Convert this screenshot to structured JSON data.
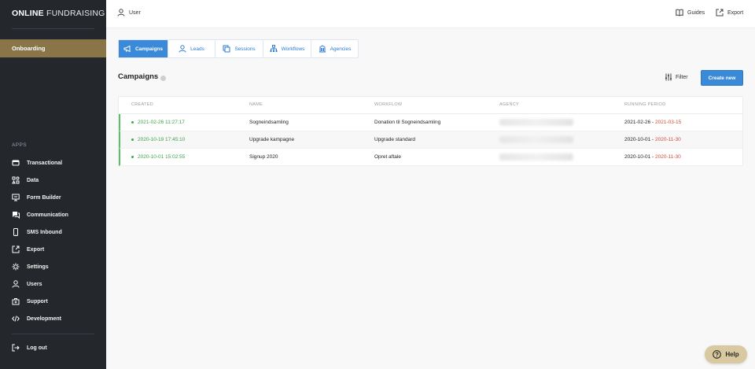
{
  "brand": {
    "bold": "ONLINE",
    "light": "FUNDRAISING"
  },
  "sidebar": {
    "onboarding": "Onboarding",
    "apps_title": "APPS",
    "items": [
      {
        "label": "Transactional",
        "icon": "wallet-icon"
      },
      {
        "label": "Data",
        "icon": "data-icon"
      },
      {
        "label": "Form Builder",
        "icon": "monitor-icon"
      },
      {
        "label": "Communication",
        "icon": "chat-icon"
      },
      {
        "label": "SMS Inbound",
        "icon": "phone-icon"
      },
      {
        "label": "Export",
        "icon": "export-icon"
      },
      {
        "label": "Settings",
        "icon": "gear-icon"
      },
      {
        "label": "Users",
        "icon": "user-icon"
      },
      {
        "label": "Support",
        "icon": "support-icon"
      },
      {
        "label": "Development",
        "icon": "code-icon"
      }
    ],
    "logout": "Log out"
  },
  "topbar": {
    "user": "User",
    "guides": "Guides",
    "export": "Export"
  },
  "tabs": [
    {
      "label": "Campaigns",
      "active": true
    },
    {
      "label": "Leads",
      "active": false
    },
    {
      "label": "Sessions",
      "active": false
    },
    {
      "label": "Workflows",
      "active": false
    },
    {
      "label": "Agencies",
      "active": false
    }
  ],
  "page": {
    "title": "Campaigns",
    "filter": "Filter",
    "create": "Create new"
  },
  "table": {
    "headers": [
      "CREATED",
      "NAME",
      "WORKFLOW",
      "AGENCY",
      "RUNNING PERIOD"
    ],
    "rows": [
      {
        "created": "2021-02-26 11:27:17",
        "name": "Sogneindsamling",
        "workflow": "Donation til Sogneindsamling",
        "agency": "",
        "start": "2021-02-26",
        "sep": " - ",
        "end": "2021-03-15"
      },
      {
        "created": "2020-10-19 17:45:10",
        "name": "Upgrade kampagne",
        "workflow": "Upgrade standard",
        "agency": "",
        "start": "2020-10-01",
        "sep": " - ",
        "end": "2020-11-30"
      },
      {
        "created": "2020-10-01 15:02:55",
        "name": "Signup 2020",
        "workflow": "Opret aftale",
        "agency": "",
        "start": "2020-10-01",
        "sep": " - ",
        "end": "2020-11-30"
      }
    ]
  },
  "help": "Help",
  "colors": {
    "sidebar": "#24272c",
    "accent": "#3b8ad9",
    "onboarding": "#8a7549",
    "status": "#3fa34d",
    "end_date": "#d64a3b"
  }
}
